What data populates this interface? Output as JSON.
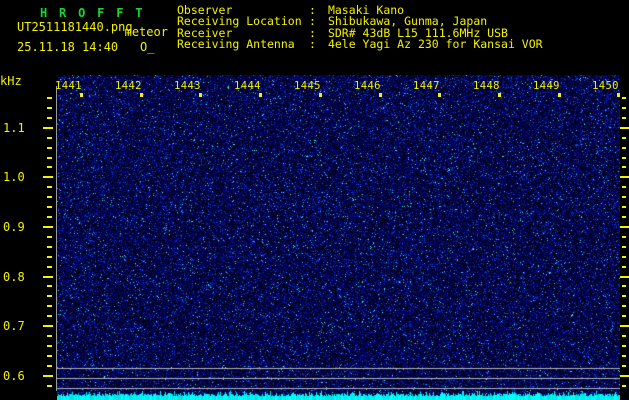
{
  "header": {
    "title": "H R O F F T",
    "filename": "UT2511181440.png",
    "overlay_label": "meteor",
    "datetime": "25.11.18 14:40",
    "counter": "O_",
    "colon": ":",
    "info": [
      {
        "label": "Observer",
        "value": "Masaki Kano"
      },
      {
        "label": "Receiving Location",
        "value": "Shibukawa, Gunma, Japan"
      },
      {
        "label": "Receiver",
        "value": "SDR# 43dB L15 111.6MHz USB"
      },
      {
        "label": "Receiving Antenna",
        "value": "4ele Yagi Az 230 for Kansai VOR"
      }
    ]
  },
  "axes": {
    "freq_unit": "kHz",
    "freq_tick_labels": [
      "1.1",
      "1.0",
      "0.9",
      "0.8",
      "0.7",
      "0.6"
    ],
    "time_tick_labels": [
      "1441",
      "1442",
      "1443",
      "1444",
      "1445",
      "1446",
      "1447",
      "1448",
      "1449",
      "1450"
    ]
  },
  "spectrogram": {
    "description": "10-minute meteor-scatter radio spectrogram filled with uniform dark-blue background noise; no meteor echoes visible",
    "carrier_lines_khz": [
      0.62,
      0.6,
      0.58
    ],
    "noise_level_strip": "jagged cyan signal-level bar along the bottom edge"
  },
  "colors": {
    "background": "#000000",
    "text_yellow": "#f2f200",
    "title_green": "#17d62c",
    "noise_blue": "#0000aa",
    "carrier_gray": "#c3c3c3",
    "level_cyan": "#00ffff"
  }
}
